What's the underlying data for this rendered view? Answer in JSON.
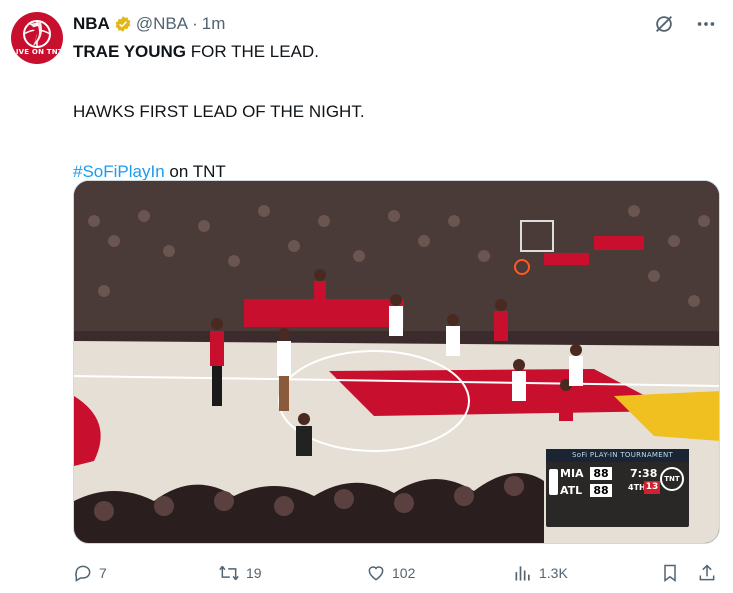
{
  "post": {
    "author": {
      "name": "NBA",
      "handle": "@NBA",
      "verified": true,
      "avatar_caption": "LIVE ON TNT",
      "avatar_color": "#c8102e"
    },
    "separator": "·",
    "time": "1m",
    "text": {
      "bold_lead": "TRAE YOUNG",
      "line1_rest": " FOR THE LEAD.",
      "line2": "HAWKS FIRST LEAD OF THE NIGHT.",
      "hashtag": "#SoFiPlayIn",
      "hashtag_rest": " on TNT"
    },
    "media": {
      "scoreboard": {
        "banner": "SoFi PLAY-IN TOURNAMENT",
        "away_team": "MIA",
        "away_score": "88",
        "home_team": "ATL",
        "home_score": "88",
        "clock": "7:38",
        "quarter": "4TH",
        "shot_clock": "13",
        "network": "TNT"
      }
    },
    "actions": {
      "replies": "7",
      "reposts": "19",
      "likes": "102",
      "views": "1.3K"
    },
    "top_icons": [
      "grok-icon",
      "more-icon"
    ],
    "colors": {
      "link": "#1d9bf0",
      "secondary_text": "#536471",
      "verified_badge": "#e2b719"
    }
  }
}
